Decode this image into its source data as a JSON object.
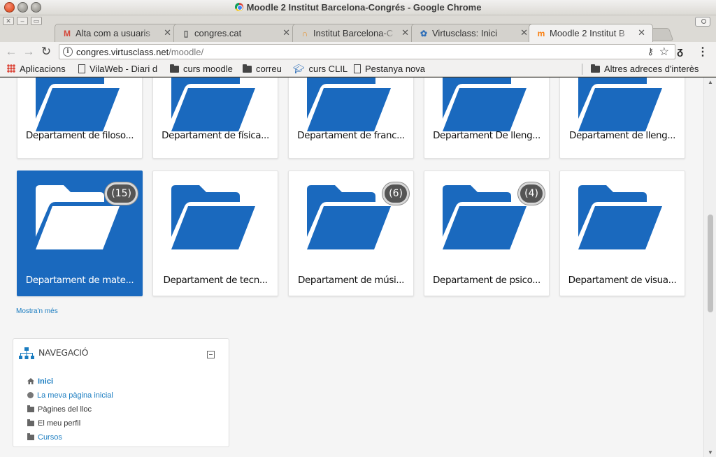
{
  "window": {
    "title": "Moodle 2 Institut Barcelona-Congrés - Google Chrome"
  },
  "tabs": [
    {
      "label": "Alta com a usuaris",
      "icon": "gmail-icon",
      "icon_glyph": "M",
      "icon_color": "#d44638",
      "active": false
    },
    {
      "label": "congres.cat",
      "icon": "page-icon",
      "icon_glyph": "▯",
      "icon_color": "#555555",
      "active": false
    },
    {
      "label": "Institut Barcelona-C",
      "icon": "institut-icon",
      "icon_glyph": "∩",
      "icon_color": "#e8912a",
      "active": false
    },
    {
      "label": "Virtusclass: Inici",
      "icon": "virtusclass-icon",
      "icon_glyph": "✿",
      "icon_color": "#2f6fb8",
      "active": false
    },
    {
      "label": "Moodle 2 Institut B",
      "icon": "moodle-icon",
      "icon_glyph": "m",
      "icon_color": "#f98012",
      "active": true
    }
  ],
  "toolbar": {
    "url_host": "congres.virtusclass.net",
    "url_path": "/moodle/"
  },
  "bookmarks": {
    "items": [
      {
        "label": "Aplicacions",
        "icon": "apps-icon"
      },
      {
        "label": "VilaWeb - Diari d",
        "icon": "page-icon"
      },
      {
        "label": "curs moodle",
        "icon": "folder-icon"
      },
      {
        "label": "correu",
        "icon": "folder-icon"
      },
      {
        "label": "curs CLIL",
        "icon": "graduation-cap-icon"
      },
      {
        "label": "Pestanya nova",
        "icon": "page-icon"
      }
    ],
    "other": "Altres adreces d'interès"
  },
  "categories": {
    "row1": [
      {
        "label": "Departament de filoso..."
      },
      {
        "label": "Departament de física..."
      },
      {
        "label": "Departament de franc..."
      },
      {
        "label": "Departament De lleng..."
      },
      {
        "label": "Departament de lleng..."
      }
    ],
    "row2": [
      {
        "label": "Departament de mate...",
        "count": "(15)",
        "active": true
      },
      {
        "label": "Departament de tecn...",
        "count": ""
      },
      {
        "label": "Departament de músi...",
        "count": "(6)"
      },
      {
        "label": "Departament de psico...",
        "count": "(4)"
      },
      {
        "label": "Departament de visua...",
        "count": ""
      }
    ],
    "show_more": "Mostra'n més"
  },
  "navigation": {
    "title": "NAVEGACIÓ",
    "items": [
      {
        "label": "Inici",
        "icon": "home-icon"
      },
      {
        "label": "La meva pàgina inicial",
        "icon": "circle-icon"
      },
      {
        "label": "Pàgines del lloc",
        "icon": "folder-icon"
      },
      {
        "label": "El meu perfil",
        "icon": "folder-icon"
      },
      {
        "label": "Cursos",
        "icon": "folder-icon"
      }
    ]
  },
  "colors": {
    "folder_blue": "#1a69be",
    "link_blue": "#1a7cc0",
    "badge_bg": "#555555"
  }
}
